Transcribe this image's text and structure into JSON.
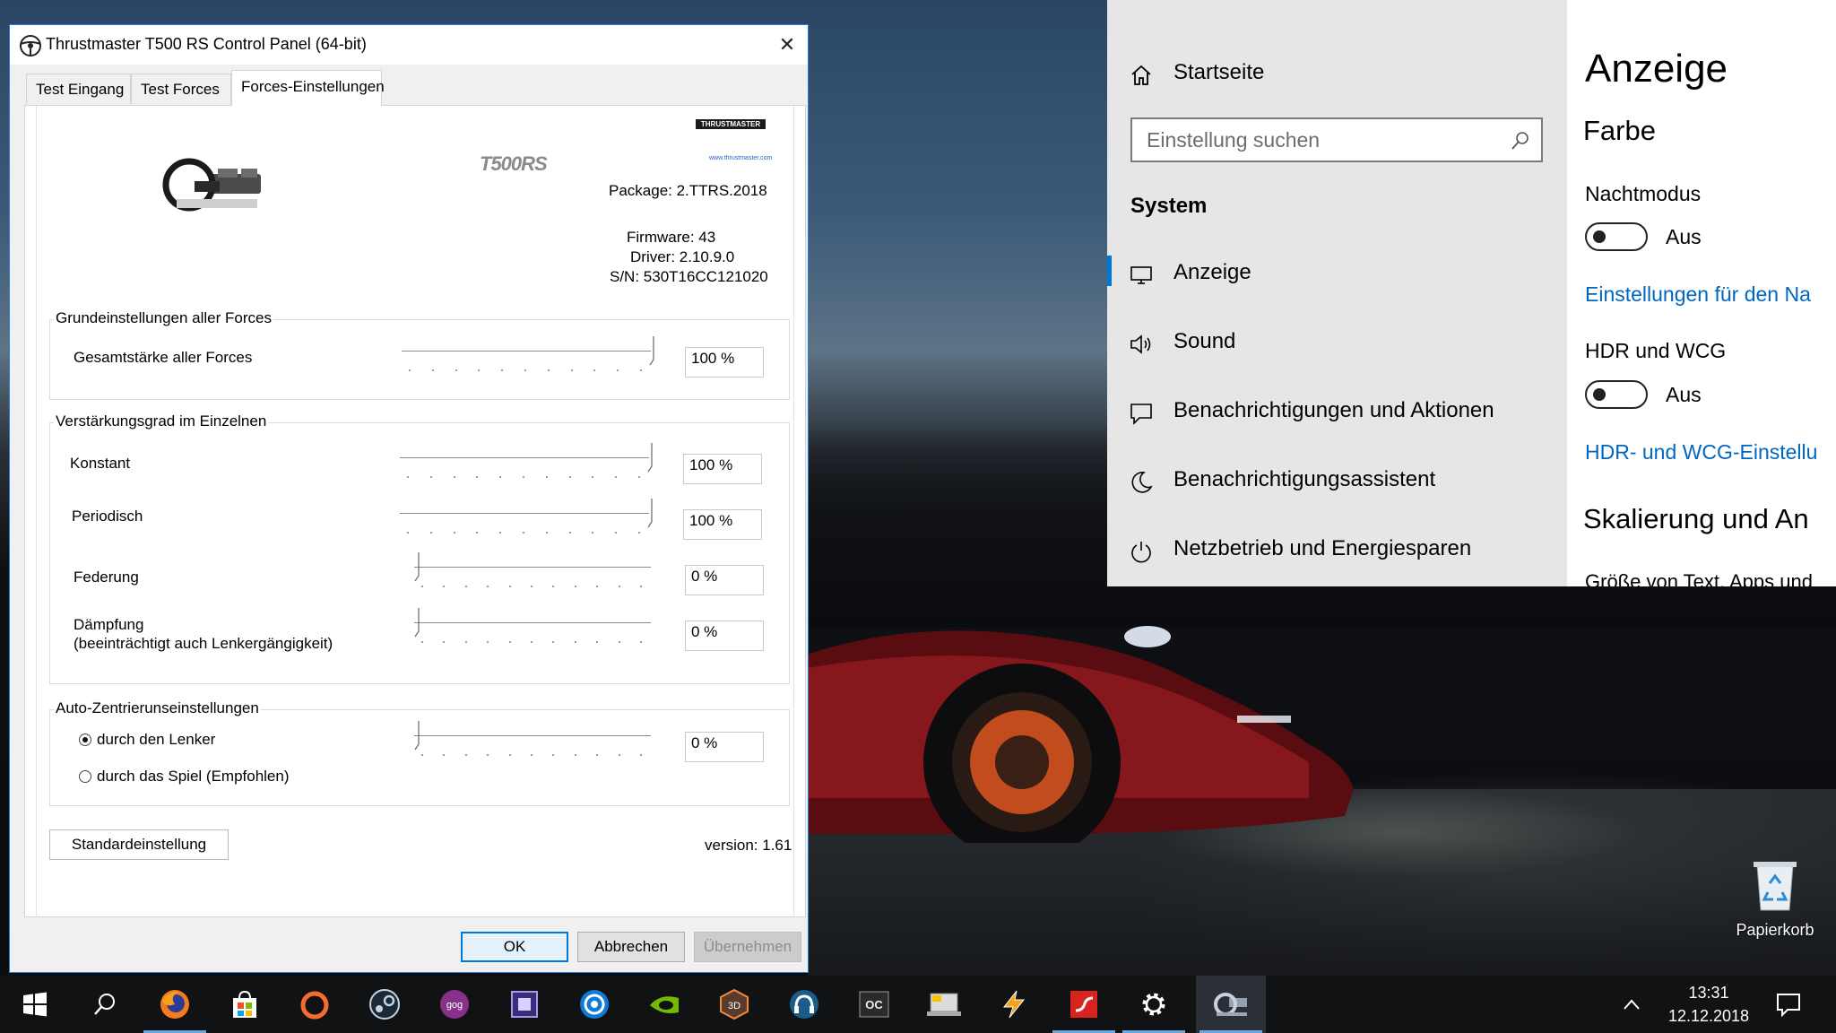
{
  "thrustmaster": {
    "title": "Thrustmaster T500 RS Control Panel (64-bit)",
    "close_glyph": "✕",
    "tabs": [
      {
        "label": "Test Eingang"
      },
      {
        "label": "Test Forces"
      },
      {
        "label": "Forces-Einstellungen"
      }
    ],
    "active_tab": "Forces-Einstellungen",
    "brand": "THRUSTMASTER",
    "brand_url": "www.thrustmaster.com",
    "model_logo": "T500RS",
    "package": "Package: 2.TTRS.2018",
    "firmware": "Firmware: 43",
    "driver": "Driver: 2.10.9.0",
    "serial": "S/N: 530T16CC121020",
    "groups": {
      "basic": {
        "label": "Grundeinstellungen aller Forces",
        "rows": [
          {
            "label": "Gesamtstärke aller Forces",
            "value": "100 %",
            "level": 100
          }
        ]
      },
      "individual": {
        "label": "Verstärkungsgrad im Einzelnen",
        "rows": [
          {
            "label": "Konstant",
            "value": "100 %",
            "level": 100
          },
          {
            "label": "Periodisch",
            "value": "100 %",
            "level": 100
          },
          {
            "label": "Federung",
            "value": "0 %",
            "level": 0
          },
          {
            "label": "Dämpfung",
            "label2": "(beeinträchtigt auch Lenkergängigkeit)",
            "value": "0 %",
            "level": 0
          }
        ]
      },
      "autocenter": {
        "label": "Auto-Zentrierunseinstellungen",
        "option_wheel": "durch den Lenker",
        "option_game": "durch das Spiel (Empfohlen)",
        "selected": "durch den Lenker",
        "value": "0 %",
        "level": 0
      }
    },
    "default_button": "Standardeinstellung",
    "version": "version: 1.61",
    "buttons": {
      "ok": "OK",
      "cancel": "Abbrechen",
      "apply": "Übernehmen"
    }
  },
  "settings": {
    "home": "Startseite",
    "search_placeholder": "Einstellung suchen",
    "section": "System",
    "nav": [
      {
        "label": "Anzeige",
        "icon": "monitor-icon",
        "selected": true
      },
      {
        "label": "Sound",
        "icon": "speaker-icon"
      },
      {
        "label": "Benachrichtigungen und Aktionen",
        "icon": "notification-icon"
      },
      {
        "label": "Benachrichtigungsassistent",
        "icon": "moon-icon"
      },
      {
        "label": "Netzbetrieb und Energiesparen",
        "icon": "power-icon"
      }
    ],
    "page_title": "Anzeige",
    "color_heading": "Farbe",
    "night_mode_label": "Nachtmodus",
    "night_mode_state": "Aus",
    "night_link": "Einstellungen für den Na",
    "hdr_label": "HDR und WCG",
    "hdr_state": "Aus",
    "hdr_link": "HDR- und WCG-Einstellu",
    "scaling_heading": "Skalierung und An",
    "scaling_sub": "Größe von Text, Apps und",
    "accent_color": "#0078d7"
  },
  "desktop": {
    "recycle_bin": "Papierkorb"
  },
  "taskbar": {
    "time": "13:31",
    "date": "12.12.2018",
    "apps": [
      "start-icon",
      "search-icon",
      "firefox-icon",
      "store-icon",
      "origin-icon",
      "steam-icon",
      "gog-icon",
      "cpu-app-icon",
      "uplay-icon",
      "nvidia-icon",
      "3dmark-icon",
      "headset-icon",
      "oc-scanner-icon",
      "benchmark-icon",
      "winamp-icon",
      "flash-icon",
      "settings-icon",
      "wheel-app-icon"
    ]
  }
}
